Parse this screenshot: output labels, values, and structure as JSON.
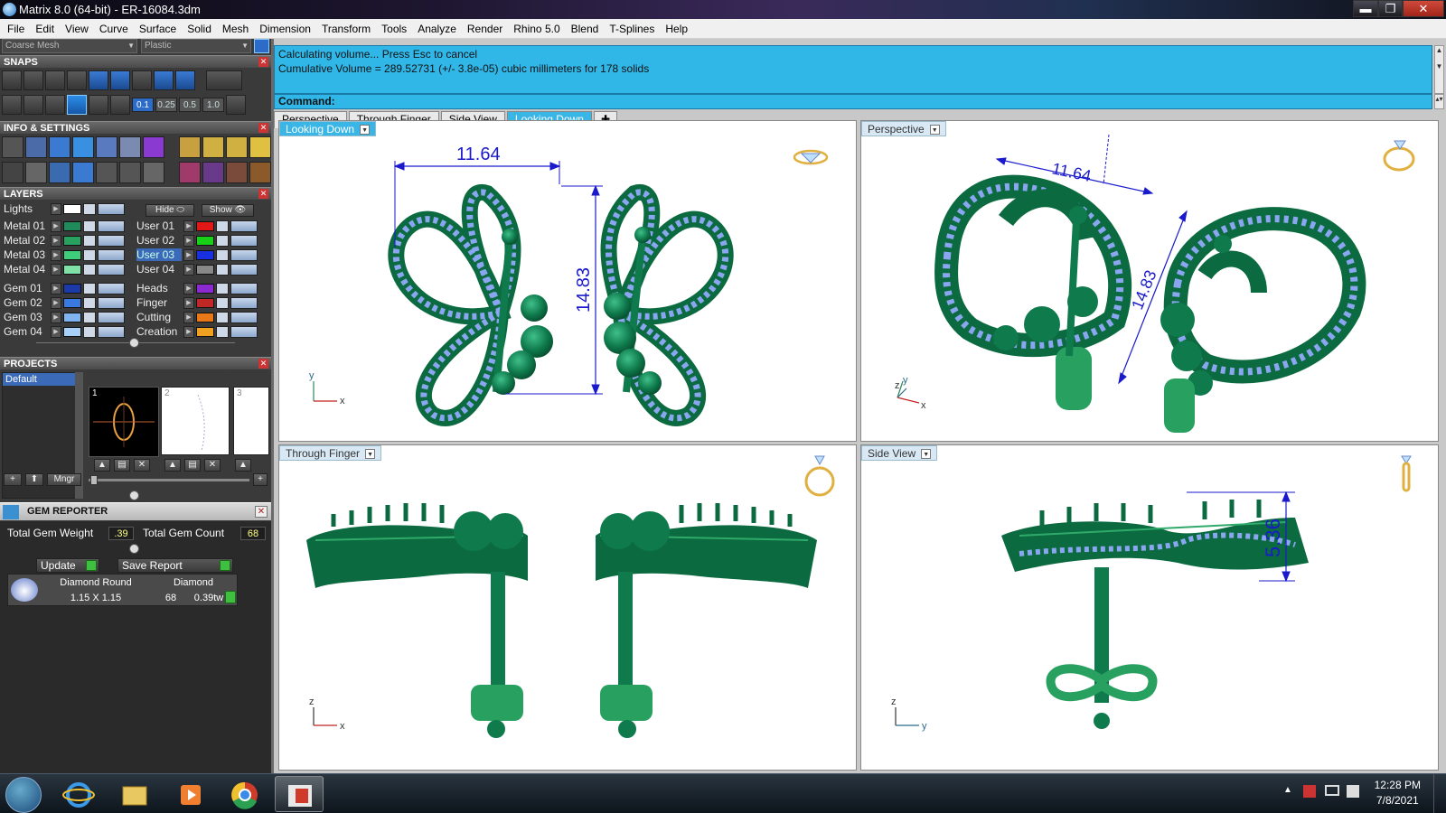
{
  "window": {
    "title": "Matrix 8.0 (64-bit) - ER-16084.3dm",
    "min_glyph": "▬",
    "max_glyph": "❐",
    "close_glyph": "✕"
  },
  "menu": [
    "File",
    "Edit",
    "View",
    "Curve",
    "Surface",
    "Solid",
    "Mesh",
    "Dimension",
    "Transform",
    "Tools",
    "Analyze",
    "Render",
    "Rhino 5.0",
    "Blend",
    "T-Splines",
    "Help"
  ],
  "toolbar_combos": {
    "mesh": "Coarse Mesh",
    "material": "Plastic",
    "arrow": "▼"
  },
  "snaps": {
    "header": "SNAPS",
    "values": [
      "0.1",
      "0.25",
      "0.5",
      "1.0"
    ]
  },
  "info": {
    "header": "INFO & SETTINGS"
  },
  "layers": {
    "header": "LAYERS",
    "lights_label": "Lights",
    "hide_label": "Hide",
    "show_label": "Show",
    "left": [
      {
        "name": "Metal 01",
        "color": "#1f8a5a"
      },
      {
        "name": "Metal 02",
        "color": "#28a060"
      },
      {
        "name": "Metal 03",
        "color": "#3fcc7a"
      },
      {
        "name": "Metal 04",
        "color": "#7fe0a8"
      },
      {
        "name": "Gem 01",
        "color": "#1b3aa8"
      },
      {
        "name": "Gem 02",
        "color": "#3a7ae0"
      },
      {
        "name": "Gem 03",
        "color": "#7fb4f0"
      },
      {
        "name": "Gem 04",
        "color": "#a8d0f8"
      }
    ],
    "right": [
      {
        "name": "User 01",
        "color": "#e01818"
      },
      {
        "name": "User 02",
        "color": "#18d018"
      },
      {
        "name": "User 03",
        "color": "#1830e0",
        "highlight": true
      },
      {
        "name": "User 04",
        "color": "#888888"
      },
      {
        "name": "Heads",
        "color": "#8a2ad0"
      },
      {
        "name": "Finger",
        "color": "#c02828"
      },
      {
        "name": "Cutting",
        "color": "#e87818"
      },
      {
        "name": "Creation",
        "color": "#f0a020"
      }
    ]
  },
  "projects": {
    "header": "PROJECTS",
    "default_label": "Default",
    "thumbs": [
      "1",
      "2",
      "3"
    ],
    "manager_label": "Mngr",
    "add_glyph": "+",
    "up_glyph": "⬆"
  },
  "gem_reporter": {
    "header": "GEM REPORTER",
    "total_weight_label": "Total Gem Weight",
    "total_weight": ".39",
    "total_count_label": "Total Gem Count",
    "total_count": "68",
    "update_label": "Update",
    "save_label": "Save Report",
    "row": {
      "shape": "Diamond Round",
      "material": "Diamond",
      "size": "1.15 X 1.15",
      "count": "68",
      "weight": "0.39tw"
    }
  },
  "command": {
    "line1": "Calculating volume... Press Esc to cancel",
    "line2": "Cumulative Volume = 289.52731 (+/- 3.8e-05) cubic millimeters for 178 solids",
    "prompt": "Command:"
  },
  "tabs": [
    "Perspective",
    "Through Finger",
    "Side View",
    "Looking Down"
  ],
  "active_tab": "Looking Down",
  "viewports": {
    "looking_down": {
      "label": "Looking Down",
      "dim_w": "11.64",
      "dim_h": "14.83",
      "axis1": "y",
      "axis2": "x"
    },
    "perspective": {
      "label": "Perspective",
      "dim_w": "11.64",
      "dim_h": "14.83",
      "axis1": "z",
      "axis2": "y",
      "axis3": "x"
    },
    "through_finger": {
      "label": "Through Finger",
      "axis1": "z",
      "axis2": "x"
    },
    "side_view": {
      "label": "Side View",
      "dim_h": "5.36",
      "axis1": "z",
      "axis2": "y"
    }
  },
  "taskbar": {
    "time": "12:28 PM",
    "date": "7/8/2021"
  },
  "colors": {
    "accent": "#39b6e6",
    "metal": "#0f7a4c",
    "gem": "#8aa6f0",
    "dimension": "#1a1acc"
  }
}
